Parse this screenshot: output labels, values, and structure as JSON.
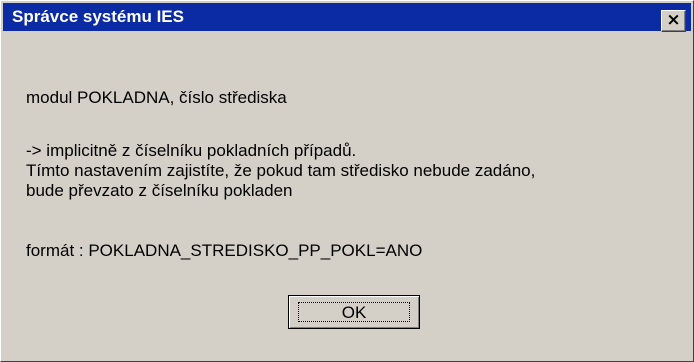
{
  "window": {
    "title": "Správce systému IES",
    "close_icon": "×"
  },
  "message": {
    "heading": "modul POKLADNA, číslo střediska",
    "lines": [
      "-> implicitně z číselníku pokladních případů.",
      "Tímto nastavením zajistíte, že pokud tam středisko nebude zadáno,",
      "bude převzato z číselníku pokladen"
    ],
    "format": "formát : POKLADNA_STREDISKO_PP_POKL=ANO"
  },
  "buttons": {
    "ok_label": "OK"
  },
  "icons": {
    "close": "close-icon"
  },
  "colors": {
    "title_bar": "#0b2ba5",
    "dialog_background": "#d4d0c8"
  }
}
